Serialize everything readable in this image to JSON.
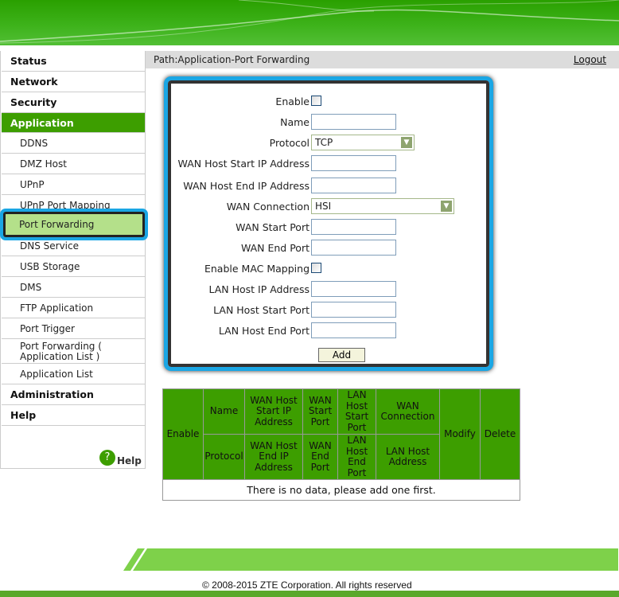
{
  "header": {
    "brand_color": "#3d9e00"
  },
  "path": {
    "text": "Path:Application-Port Forwarding",
    "logout": "Logout"
  },
  "sidebar": {
    "items": [
      {
        "label": "Status",
        "level": "top"
      },
      {
        "label": "Network",
        "level": "top"
      },
      {
        "label": "Security",
        "level": "top"
      },
      {
        "label": "Application",
        "level": "top",
        "selected": true
      },
      {
        "label": "DDNS"
      },
      {
        "label": "DMZ Host"
      },
      {
        "label": "UPnP"
      },
      {
        "label": "UPnP Port Mapping"
      },
      {
        "label": "Port Forwarding",
        "selected": true
      },
      {
        "label": "DNS Service"
      },
      {
        "label": "USB Storage"
      },
      {
        "label": "DMS"
      },
      {
        "label": "FTP Application"
      },
      {
        "label": "Port Trigger"
      },
      {
        "label": "Port Forwarding ( Application List )"
      },
      {
        "label": "Application List"
      },
      {
        "label": "Administration",
        "level": "top"
      },
      {
        "label": "Help",
        "level": "top"
      }
    ],
    "help_icon": "question-circle-icon",
    "help_label": "Help"
  },
  "form": {
    "enable": {
      "label": "Enable",
      "checked": false
    },
    "name": {
      "label": "Name",
      "value": ""
    },
    "protocol": {
      "label": "Protocol",
      "value": "TCP"
    },
    "wan_host_start_ip": {
      "label": "WAN Host Start IP Address",
      "value": ""
    },
    "wan_host_end_ip": {
      "label": "WAN Host End IP Address",
      "value": ""
    },
    "wan_connection": {
      "label": "WAN Connection",
      "value": "HSI"
    },
    "wan_start_port": {
      "label": "WAN Start Port",
      "value": ""
    },
    "wan_end_port": {
      "label": "WAN End Port",
      "value": ""
    },
    "enable_mac": {
      "label": "Enable MAC Mapping",
      "checked": false
    },
    "lan_host_ip": {
      "label": "LAN Host IP Address",
      "value": ""
    },
    "lan_host_start_port": {
      "label": "LAN Host Start Port",
      "value": ""
    },
    "lan_host_end_port": {
      "label": "LAN Host End Port",
      "value": ""
    },
    "add_label": "Add"
  },
  "table": {
    "enable": "Enable",
    "name": "Name",
    "protocol": "Protocol",
    "wan_host_start": "WAN Host Start IP Address",
    "wan_host_end": "WAN Host End IP Address",
    "wan_start_port": "WAN Start Port",
    "wan_end_port": "WAN End Port",
    "lan_host_start_port": "LAN Host Start Port",
    "lan_host_end_port": "LAN Host End Port",
    "wan_connection": "WAN Connection",
    "lan_host_address": "LAN Host Address",
    "modify": "Modify",
    "delete": "Delete",
    "empty": "There is no data, please add one first."
  },
  "footer": {
    "copyright": "© 2008-2015 ZTE Corporation. All rights reserved"
  }
}
